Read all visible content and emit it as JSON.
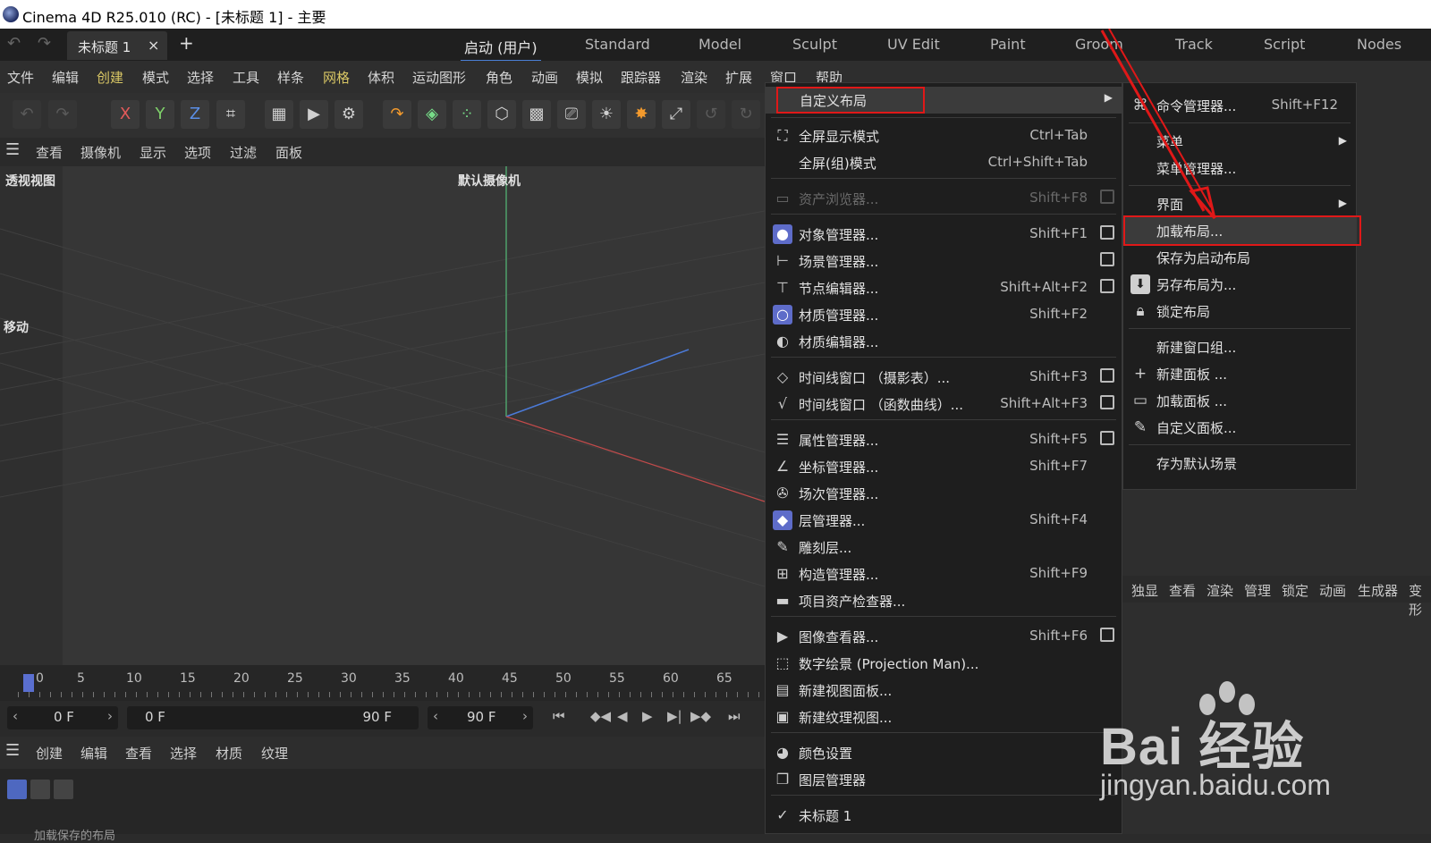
{
  "window": {
    "title": "Cinema 4D R25.010 (RC) - [未标题 1] - 主要"
  },
  "tabs": {
    "document": "未标题 1",
    "close": "×",
    "add": "+",
    "layouts": [
      "启动 (用户)",
      "Standard",
      "Model",
      "Sculpt",
      "UV Edit",
      "Paint",
      "Groom",
      "Track",
      "Script",
      "Nodes"
    ],
    "active_layout": "启动 (用户)"
  },
  "menubar": {
    "items": [
      "文件",
      "编辑",
      "创建",
      "模式",
      "选择",
      "工具",
      "样条",
      "网格",
      "体积",
      "运动图形",
      "角色",
      "动画",
      "模拟",
      "跟踪器",
      "渲染",
      "扩展",
      "窗口",
      "帮助"
    ]
  },
  "toolbar": {
    "axis_x": "X",
    "axis_y": "Y",
    "axis_z": "Z"
  },
  "viewport_menu": {
    "items": [
      "查看",
      "摄像机",
      "显示",
      "选项",
      "过滤",
      "面板"
    ]
  },
  "viewport": {
    "name": "透视视图",
    "camera": "默认摄像机",
    "tool": "移动"
  },
  "timeline": {
    "ticks": [
      "0",
      "5",
      "10",
      "15",
      "20",
      "25",
      "30",
      "35",
      "40",
      "45",
      "50",
      "55",
      "60",
      "65"
    ]
  },
  "transport": {
    "current_frame": "0 F",
    "range_start": "0 F",
    "range_end": "90 F",
    "end_frame": "90 F"
  },
  "material_menu": {
    "items": [
      "创建",
      "编辑",
      "查看",
      "选择",
      "材质",
      "纹理"
    ]
  },
  "material_area": {
    "status": "加载保存的布局"
  },
  "right_panel": {
    "tabs": [
      "独显",
      "查看",
      "渲染",
      "管理",
      "锁定",
      "动画",
      "生成器",
      "变形"
    ]
  },
  "window_menu": {
    "items": [
      {
        "label": "自定义布局",
        "shortcut": "",
        "submenu": true
      },
      {
        "label": "全屏显示模式",
        "shortcut": "Ctrl+Tab"
      },
      {
        "label": "全屏(组)模式",
        "shortcut": "Ctrl+Shift+Tab"
      },
      {
        "label": "资产浏览器...",
        "shortcut": "Shift+F8",
        "disabled": true
      },
      {
        "label": "对象管理器...",
        "shortcut": "Shift+F1"
      },
      {
        "label": "场景管理器...",
        "shortcut": ""
      },
      {
        "label": "节点编辑器...",
        "shortcut": "Shift+Alt+F2"
      },
      {
        "label": "材质管理器...",
        "shortcut": "Shift+F2"
      },
      {
        "label": "材质编辑器...",
        "shortcut": ""
      },
      {
        "label": "时间线窗口 （摄影表）...",
        "shortcut": "Shift+F3"
      },
      {
        "label": "时间线窗口 （函数曲线）...",
        "shortcut": "Shift+Alt+F3"
      },
      {
        "label": "属性管理器...",
        "shortcut": "Shift+F5"
      },
      {
        "label": "坐标管理器...",
        "shortcut": "Shift+F7"
      },
      {
        "label": "场次管理器...",
        "shortcut": ""
      },
      {
        "label": "层管理器...",
        "shortcut": "Shift+F4"
      },
      {
        "label": "雕刻层...",
        "shortcut": ""
      },
      {
        "label": "构造管理器...",
        "shortcut": "Shift+F9"
      },
      {
        "label": "项目资产检查器...",
        "shortcut": ""
      },
      {
        "label": "图像查看器...",
        "shortcut": "Shift+F6"
      },
      {
        "label": "数字绘景 (Projection Man)...",
        "shortcut": ""
      },
      {
        "label": "新建视图面板...",
        "shortcut": ""
      },
      {
        "label": "新建纹理视图...",
        "shortcut": ""
      },
      {
        "label": "颜色设置",
        "shortcut": ""
      },
      {
        "label": "图层管理器",
        "shortcut": ""
      },
      {
        "label": "未标题 1",
        "shortcut": ""
      }
    ]
  },
  "submenu": {
    "items": [
      {
        "label": "命令管理器...",
        "shortcut": "Shift+F12"
      },
      {
        "label": "菜单",
        "submenu": true
      },
      {
        "label": "菜单管理器..."
      },
      {
        "label": "界面",
        "submenu": true
      },
      {
        "label": "加载布局..."
      },
      {
        "label": "保存为启动布局"
      },
      {
        "label": "另存布局为..."
      },
      {
        "label": "锁定布局"
      },
      {
        "label": "新建窗口组..."
      },
      {
        "label": "新建面板 ..."
      },
      {
        "label": "加载面板 ..."
      },
      {
        "label": "自定义面板..."
      },
      {
        "label": "存为默认场景"
      }
    ]
  },
  "watermark": {
    "brand": "Bai 经验",
    "url": "jingyan.baidu.com"
  },
  "colors": {
    "accent_blue": "#4a7fd6",
    "highlight_red": "#e01818",
    "menu_bg": "#1e1e1e"
  }
}
